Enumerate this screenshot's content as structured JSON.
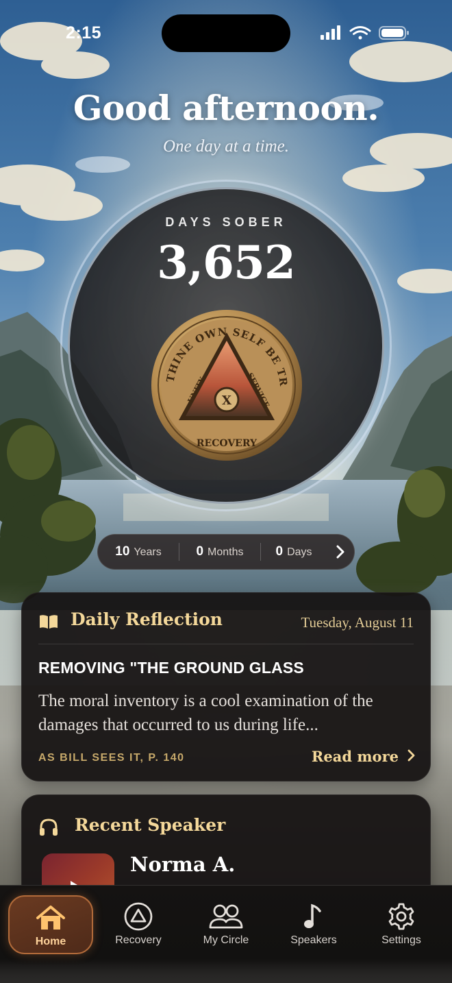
{
  "status_bar": {
    "time": "2:15"
  },
  "greeting": {
    "title": "Good afternoon.",
    "tagline": "One day at a time."
  },
  "counter": {
    "label": "DAYS SOBER",
    "value": "3,652",
    "medallion": {
      "motto": "TO THINE OWN SELF BE TRUE",
      "left_word": "UNITY",
      "right_word": "SERVICE",
      "center": "X",
      "bottom": "RECOVERY"
    }
  },
  "duration": {
    "years": {
      "value": "10",
      "unit": "Years"
    },
    "months": {
      "value": "0",
      "unit": "Months"
    },
    "days": {
      "value": "0",
      "unit": "Days"
    }
  },
  "daily_reflection": {
    "title": "Daily Reflection",
    "date": "Tuesday, August 11",
    "heading": "REMOVING \"THE GROUND GLASS",
    "body": "The moral inventory is a cool examination of the damages that occurred to us during life...",
    "source": "AS BILL SEES IT, P. 140",
    "read_more": "Read more"
  },
  "recent_speaker": {
    "title": "Recent Speaker",
    "name": "Norma A."
  },
  "tabs": [
    {
      "label": "Home",
      "icon": "home-icon",
      "active": true
    },
    {
      "label": "Recovery",
      "icon": "triangle-circle-icon",
      "active": false
    },
    {
      "label": "My Circle",
      "icon": "people-icon",
      "active": false
    },
    {
      "label": "Speakers",
      "icon": "music-note-icon",
      "active": false
    },
    {
      "label": "Settings",
      "icon": "gear-icon",
      "active": false
    }
  ],
  "colors": {
    "accent_gold": "#f4d89a",
    "tab_active_bg": "#5c321d",
    "card_bg": "#161313"
  }
}
